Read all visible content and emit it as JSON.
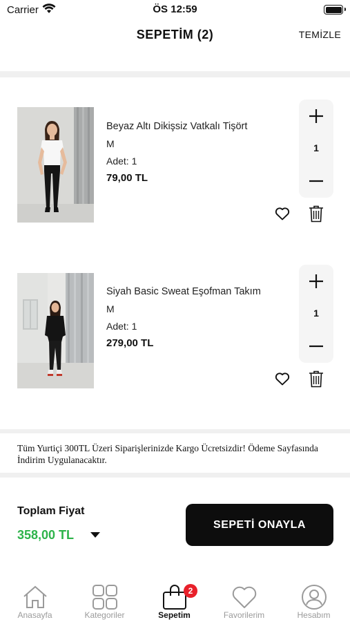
{
  "status_bar": {
    "carrier": "Carrier",
    "time": "ÖS 12:59"
  },
  "header": {
    "title": "SEPETİM  (2)",
    "clear_label": "TEMİZLE"
  },
  "cart_items": [
    {
      "name": "Beyaz Altı Dikişsiz Vatkalı Tişört",
      "size": "M",
      "quantity_label": "Adet:  1",
      "price": "79,00 TL",
      "quantity": "1",
      "image": "woman-white-tshirt-photo"
    },
    {
      "name": "Siyah Basic Sweat Eşofman Takım",
      "size": "M",
      "quantity_label": "Adet:  1",
      "price": "279,00 TL",
      "quantity": "1",
      "image": "woman-black-tracksuit-photo"
    }
  ],
  "notice": "Tüm Yurtiçi 300TL Üzeri Siparişlerinizde Kargo Ücretsizdir! Ödeme Sayfasında İndirim Uygulanacaktır.",
  "summary": {
    "total_label": "Toplam Fiyat",
    "total_price": "358,00 TL",
    "confirm_label": "SEPETİ ONAYLA"
  },
  "tabs": [
    {
      "label": "Anasayfa",
      "icon": "home-icon",
      "active": false
    },
    {
      "label": "Kategoriler",
      "icon": "grid-icon",
      "active": false
    },
    {
      "label": "Sepetim",
      "icon": "shopping-bag-icon",
      "active": true,
      "badge": "2"
    },
    {
      "label": "Favorilerim",
      "icon": "heart-icon",
      "active": false
    },
    {
      "label": "Hesabım",
      "icon": "user-icon",
      "active": false
    }
  ],
  "colors": {
    "price_green": "#2db34a",
    "badge_red": "#e8202a",
    "button_black": "#0d0d0d",
    "inactive_gray": "#9a9a9a"
  }
}
